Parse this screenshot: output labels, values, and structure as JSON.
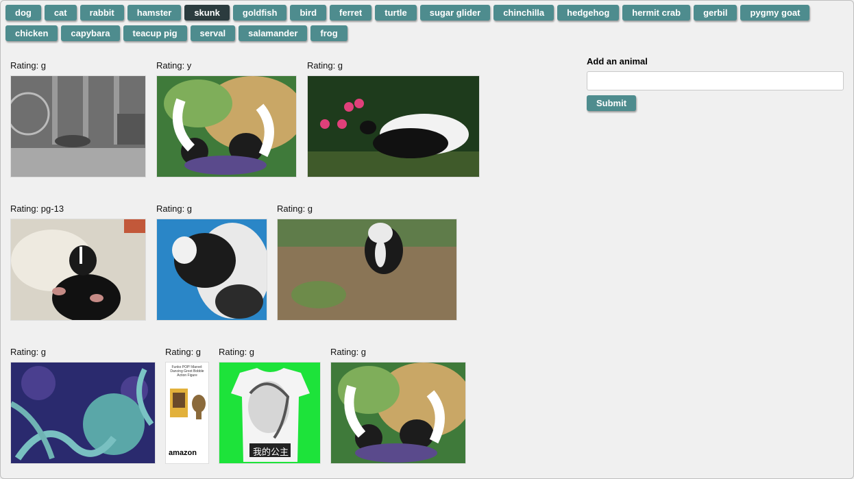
{
  "animals": {
    "buttons": [
      "dog",
      "cat",
      "rabbit",
      "hamster",
      "skunk",
      "goldfish",
      "bird",
      "ferret",
      "turtle",
      "sugar glider",
      "chinchilla",
      "hedgehog",
      "hermit crab",
      "gerbil",
      "pygmy goat",
      "chicken",
      "capybara",
      "teacup pig",
      "serval",
      "salamander",
      "frog"
    ],
    "active": "skunk"
  },
  "gifs": [
    {
      "rating": "Rating: g"
    },
    {
      "rating": "Rating: y"
    },
    {
      "rating": "Rating: g"
    },
    {
      "rating": "Rating: pg-13"
    },
    {
      "rating": "Rating: g"
    },
    {
      "rating": "Rating: g"
    },
    {
      "rating": "Rating: g"
    },
    {
      "rating": "Rating: g"
    },
    {
      "rating": "Rating: g"
    },
    {
      "rating": "Rating: g"
    }
  ],
  "thumb_text": {
    "funko_caption": "Funko POP! Marvel: Dancing Groot Bobble Action Figure",
    "funko_brand": "amazon",
    "tshirt_text": "我的公主"
  },
  "form": {
    "label": "Add an animal",
    "input_value": "",
    "submit_label": "Submit"
  }
}
